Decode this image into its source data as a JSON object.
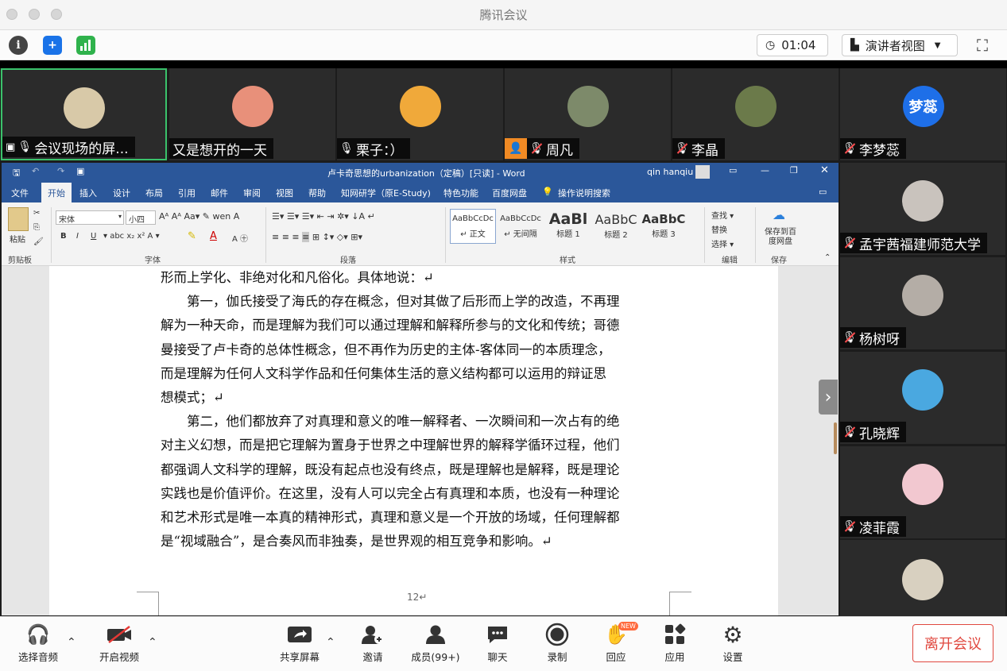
{
  "window": {
    "title": "腾讯会议"
  },
  "toolbar": {
    "timer": "01:04",
    "view_label": "演讲者视图"
  },
  "participants_top": [
    {
      "name": "会议现场的屏...",
      "avatar_color": "#d8c9a8",
      "mic": "on",
      "active": true
    },
    {
      "name": "又是想开的一天",
      "avatar_color": "#e8907a",
      "mic": "none"
    },
    {
      "name": "栗子：）",
      "avatar_color": "#f0a93a",
      "mic": "on"
    },
    {
      "name": "周凡",
      "avatar_color": "#7d8a6a",
      "mic": "off",
      "orange_badge": true
    },
    {
      "name": "李晶",
      "avatar_color": "#6b7a4a",
      "mic": "off"
    },
    {
      "name": "李梦蕊",
      "avatar_color": "#1e6fe8",
      "avatar_text": "梦蕊",
      "mic": "off"
    }
  ],
  "participants_side": [
    {
      "name": "孟宇茜福建师范大学",
      "avatar_color": "#c9c3bd",
      "mic": "off"
    },
    {
      "name": "杨树呀",
      "avatar_color": "#b4ada6",
      "mic": "off"
    },
    {
      "name": "孔晓辉",
      "avatar_color": "#4aa8e0",
      "mic": "off"
    },
    {
      "name": "凌菲霞",
      "avatar_color": "#f2c8d0",
      "mic": "off"
    }
  ],
  "word": {
    "title": "卢卡奇思想的urbanization（定稿）[只读] - Word",
    "user": "qin hanqiu",
    "tabs": [
      "文件",
      "开始",
      "插入",
      "设计",
      "布局",
      "引用",
      "邮件",
      "审阅",
      "视图",
      "帮助",
      "知网研学（原E-Study)",
      "特色功能",
      "百度网盘",
      "操作说明搜索"
    ],
    "font_name": "宋体",
    "font_size": "小四",
    "groups": [
      "剪贴板",
      "字体",
      "段落",
      "样式",
      "编辑",
      "保存"
    ],
    "paste": "粘贴",
    "styles": [
      {
        "preview": "AaBbCcDc",
        "name": "↵ 正文"
      },
      {
        "preview": "AaBbCcDc",
        "name": "↵ 无间隔"
      },
      {
        "preview": "AaBl",
        "name": "标题 1"
      },
      {
        "preview": "AaBbC",
        "name": "标题 2"
      },
      {
        "preview": "AaBbC",
        "name": "标题 3"
      }
    ],
    "edit_items": [
      "查找 ▾",
      "替换",
      "选择 ▾"
    ],
    "save_label": "保存到百度网盘",
    "lines": [
      "形而上学化、非绝对化和凡俗化。具体地说：↵",
      "　　第一，伽氏接受了海氏的存在概念，但对其做了后形而上学的改造，不再理",
      "解为一种天命，而是理解为我们可以通过理解和解释所参与的文化和传统；哥德",
      "曼接受了卢卡奇的总体性概念，但不再作为历史的主体-客体同一的本质理念，",
      "而是理解为任何人文科学作品和任何集体生活的意义结构都可以运用的辩证思",
      "想模式；↵",
      "　　第二，他们都放弃了对真理和意义的唯一解释者、一次瞬间和一次占有的绝",
      "对主义幻想，而是把它理解为置身于世界之中理解世界的解释学循环过程，他们",
      "都强调人文科学的理解，既没有起点也没有终点，既是理解也是解释，既是理论",
      "实践也是价值评价。在这里，没有人可以完全占有真理和本质，也没有一种理论",
      "和艺术形式是唯一本真的精神形式，真理和意义是一个开放的场域，任何理解都",
      "是“视域融合”，是合奏风而非独奏，是世界观的相互竞争和影响。↵"
    ],
    "page_number": "12↵"
  },
  "bottom": {
    "audio": "选择音频",
    "video": "开启视频",
    "share": "共享屏幕",
    "invite": "邀请",
    "members": "成员(99+)",
    "chat": "聊天",
    "record": "录制",
    "react": "回应",
    "react_badge": "NEW",
    "apps": "应用",
    "settings": "设置",
    "leave": "离开会议"
  }
}
